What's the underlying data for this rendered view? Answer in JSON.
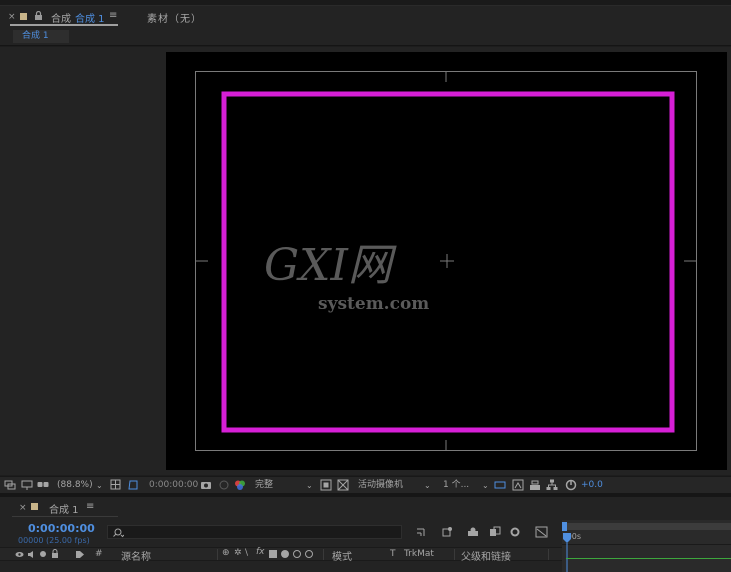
{
  "viewer_panel": {
    "tabs": [
      {
        "close": "×",
        "name": "合成",
        "comp": "合成 1",
        "menu": "≡"
      },
      {
        "name": "素材（无）"
      }
    ],
    "breadcrumb": "合成 1",
    "toolbar": {
      "zoom": "(88.8%)",
      "timecode": "0:00:00:00",
      "resolution": "完整",
      "camera": "活动摄像机",
      "views": "1 个...",
      "exposure": "+0.0"
    },
    "watermark": {
      "big": "GXI网",
      "small": "system.com"
    }
  },
  "timeline_panel": {
    "close": "×",
    "comp_name": "合成 1",
    "menu": "≡",
    "timecode": "0:00:00:00",
    "fps": "00000 (25.00 fps)",
    "columns": {
      "hash": "#",
      "source_name": "源名称",
      "mode": "模式",
      "t": "T",
      "trkmat": "TrkMat",
      "parent": "父级和链接"
    },
    "ruler_start": ":00s"
  },
  "colors": {
    "accent_blue": "#4f8fe0",
    "title_safe_magenta": "#d61fd6"
  }
}
